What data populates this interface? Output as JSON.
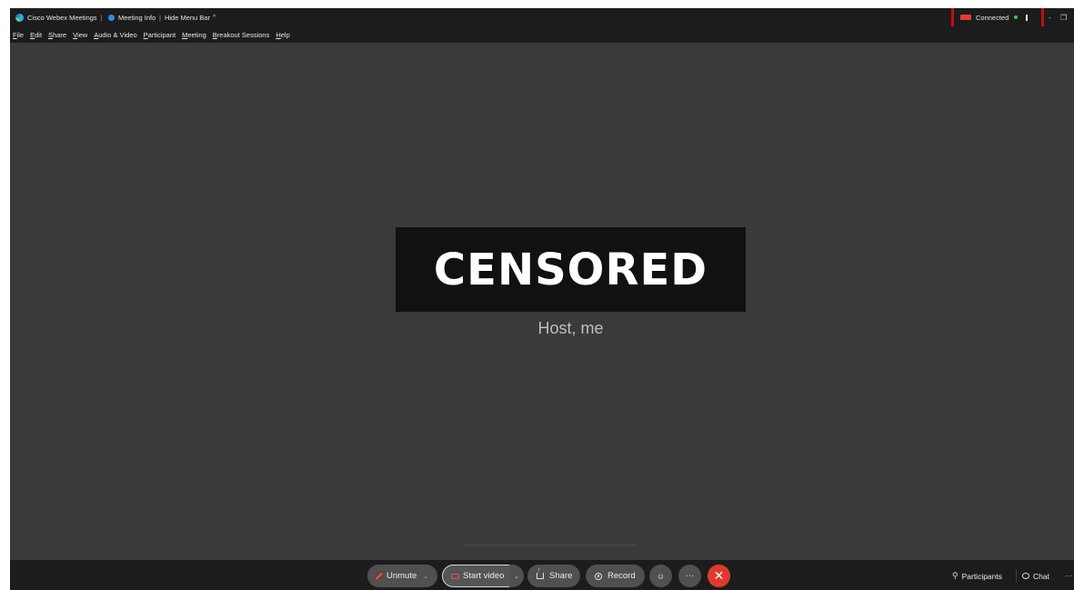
{
  "titlebar": {
    "app_name": "Cisco Webex Meetings",
    "separator": "|",
    "meeting_info_label": "Meeting Info",
    "hide_menu_label": "Hide Menu Bar",
    "chevron_up_glyph": "^",
    "connected_label": "Connected",
    "minimize_glyph": "-",
    "restore_glyph": "❐"
  },
  "menubar": {
    "items": [
      "File",
      "Edit",
      "Share",
      "View",
      "Audio & Video",
      "Participant",
      "Meeting",
      "Breakout Sessions",
      "Help"
    ]
  },
  "stage": {
    "censored_label": "CENSORED",
    "participant_name": "Host, me"
  },
  "controls": {
    "unmute_label": "Unmute",
    "start_video_label": "Start video",
    "share_label": "Share",
    "record_label": "Record",
    "caret_glyph": "⌄",
    "more_glyph": "···",
    "leave_glyph": "✕",
    "reactions_glyph": "☺"
  },
  "panels": {
    "participants_label": "Participants",
    "chat_label": "Chat",
    "more_glyph": "···"
  },
  "colors": {
    "background": "#3a3a3a",
    "bar": "#1c1c1c",
    "leave_red": "#e03a2e",
    "highlight_red": "#c10e0e",
    "connected_green": "#3ec35a"
  }
}
